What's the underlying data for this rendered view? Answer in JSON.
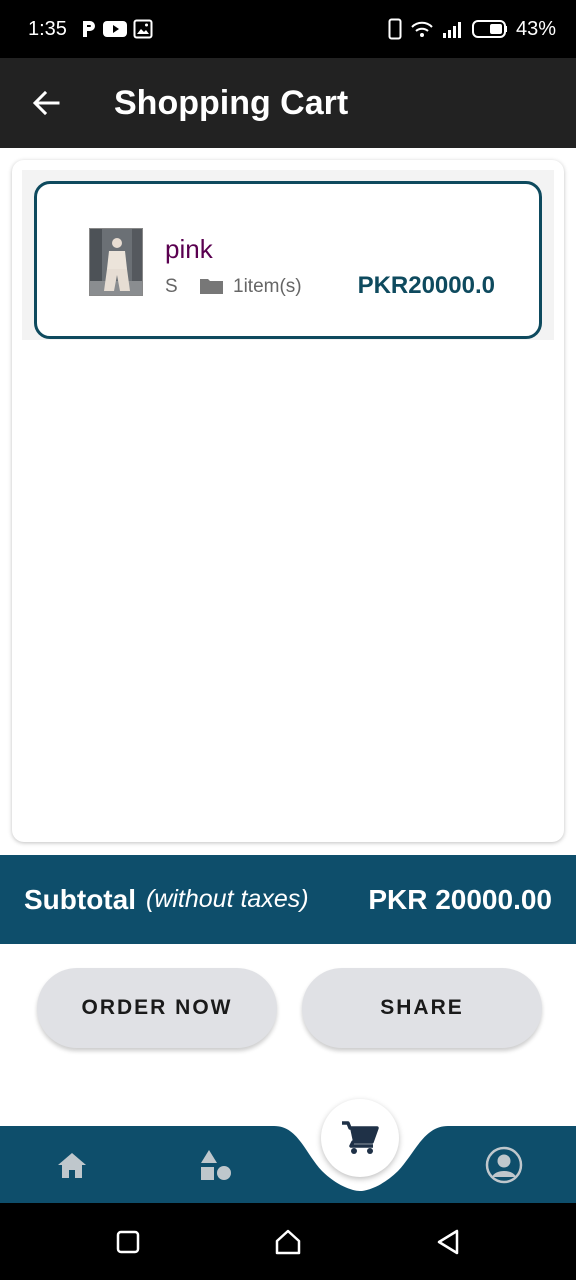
{
  "status_bar": {
    "time": "1:35",
    "battery": "43%",
    "icons": [
      "p-icon",
      "youtube-icon",
      "gallery-icon",
      "phone-icon",
      "wifi-icon",
      "signal-icon",
      "battery-icon"
    ]
  },
  "app_bar": {
    "title": "Shopping Cart"
  },
  "cart": {
    "items": [
      {
        "name": "pink",
        "size": "S",
        "quantity": "1item(s)",
        "price": "PKR20000.0"
      }
    ]
  },
  "summary": {
    "subtotal_label": "Subtotal",
    "subtotal_note": "(without taxes)",
    "subtotal_value": "PKR 20000.00"
  },
  "actions": {
    "order_label": "ORDER NOW",
    "share_label": "SHARE"
  },
  "bottom_nav": {
    "items": [
      "home-icon",
      "categories-icon",
      "cart-icon",
      "profile-icon"
    ],
    "active": "cart"
  },
  "colors": {
    "primary": "#0e4e6b",
    "app_bar": "#222222",
    "item_name": "#5a0050",
    "button_bg": "#e0e1e5"
  }
}
